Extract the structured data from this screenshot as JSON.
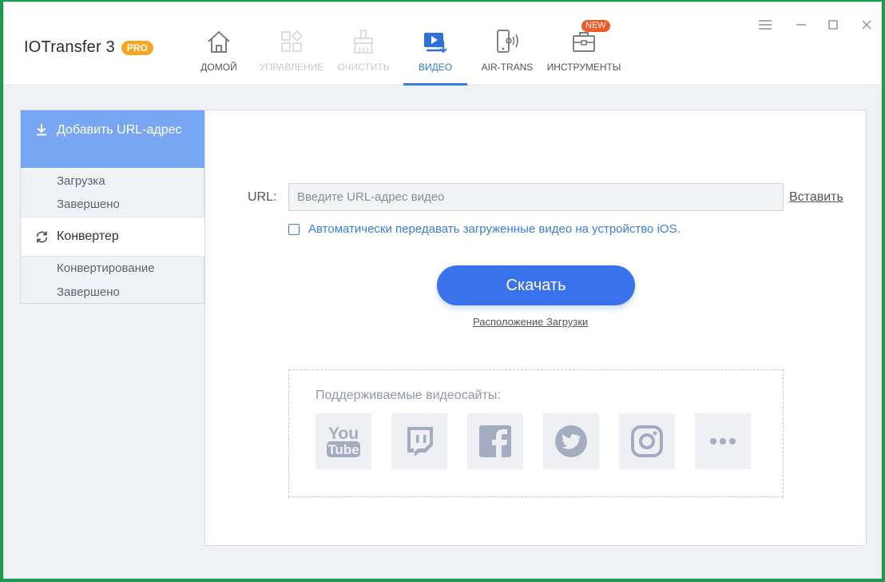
{
  "app": {
    "name": "IOTransfer 3",
    "badge": "PRO"
  },
  "nav": {
    "items": [
      {
        "label": "ДОМОЙ",
        "state": "normal",
        "icon": "home-icon"
      },
      {
        "label": "УПРАВЛЕНИЕ",
        "state": "disabled",
        "icon": "manage-icon"
      },
      {
        "label": "ОЧИСТИТЬ",
        "state": "disabled",
        "icon": "clean-icon"
      },
      {
        "label": "ВИДЕО",
        "state": "active",
        "icon": "video-download-icon"
      },
      {
        "label": "AIR-TRANS",
        "state": "normal",
        "icon": "air-trans-icon"
      },
      {
        "label": "ИНСТРУМЕНТЫ",
        "state": "normal",
        "icon": "toolbox-icon",
        "badge": "NEW"
      }
    ]
  },
  "window_controls": [
    "menu-icon",
    "minimize-icon",
    "maximize-icon",
    "close-icon"
  ],
  "sidebar": {
    "active_item": "Добавить URL-адрес",
    "download_sub": [
      "Загрузка",
      "Завершено"
    ],
    "converter_label": "Конвертер",
    "converter_sub": [
      "Конвертирование",
      "Завершено"
    ]
  },
  "main": {
    "url_label": "URL:",
    "url_placeholder": "Введите URL-адрес видео",
    "url_value": "",
    "paste_label": "Вставить",
    "auto_transfer_label": "Автоматически передавать загруженные видео на устройство iOS.",
    "auto_transfer_checked": false,
    "download_button": "Скачать",
    "location_link": "Расположение Загрузки",
    "sites_title": "Поддерживаемые видеосайты:",
    "sites": [
      {
        "icon": "youtube-icon",
        "text_top": "You",
        "text_bottom": "Tube"
      },
      {
        "icon": "twitch-icon"
      },
      {
        "icon": "facebook-icon"
      },
      {
        "icon": "twitter-icon"
      },
      {
        "icon": "instagram-icon"
      },
      {
        "icon": "more-icon"
      }
    ]
  },
  "colors": {
    "accent": "#3a72ec",
    "sidebar_active": "#79a6f2",
    "pro_badge": "#f5a623",
    "new_badge": "#f05a28",
    "site_icon": "#a4adc0",
    "desktop": "#1f9a4c"
  }
}
